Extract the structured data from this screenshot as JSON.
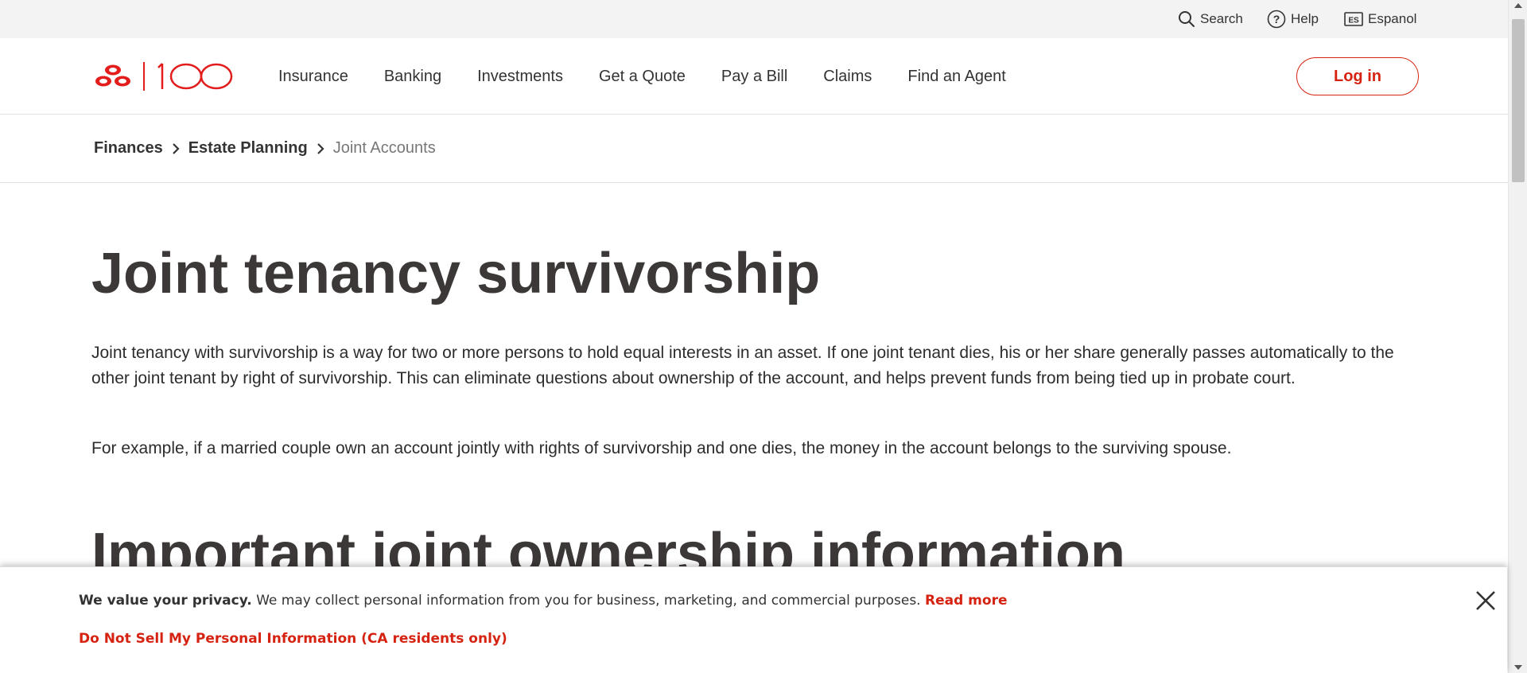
{
  "utility": {
    "search_label": "Search",
    "help_label": "Help",
    "espanol_label": "Espanol",
    "espanol_badge": "ES"
  },
  "logo": {
    "text": "100"
  },
  "nav": {
    "items": [
      "Insurance",
      "Banking",
      "Investments",
      "Get a Quote",
      "Pay a Bill",
      "Claims",
      "Find an Agent"
    ]
  },
  "header": {
    "login_label": "Log in"
  },
  "breadcrumb": {
    "items": [
      "Finances",
      "Estate Planning",
      "Joint Accounts"
    ]
  },
  "main": {
    "title": "Joint tenancy survivorship",
    "paragraph1": "Joint tenancy with survivorship is a way for two or more persons to hold equal interests in an asset. If one joint tenant dies, his or her share generally passes automatically to the other joint tenant by right of survivorship. This can eliminate questions about ownership of the account, and helps prevent funds from being tied up in probate court.",
    "paragraph2": "For example, if a married couple own an account jointly with rights of survivorship and one dies, the money in the account belongs to the surviving spouse.",
    "section_title": "Important joint ownership information"
  },
  "privacy": {
    "bold_text": "We value your privacy.",
    "text": " We may collect personal information from you for business, marketing, and commercial purposes. ",
    "read_more": "Read more",
    "do_not_sell": "Do Not Sell My Personal Information (CA residents only)"
  },
  "colors": {
    "brand_red": "#d62311",
    "text_dark": "#333333",
    "utility_bg": "#f3f3f3"
  }
}
